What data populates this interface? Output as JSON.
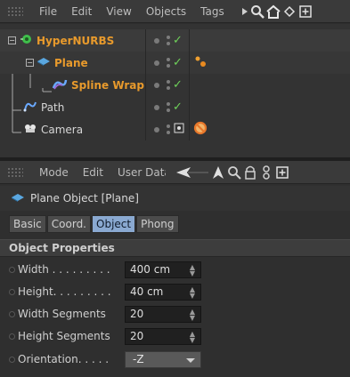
{
  "object_manager": {
    "menu": [
      "File",
      "Edit",
      "View",
      "Objects",
      "Tags"
    ],
    "objects": [
      {
        "name": "HyperNURBS"
      },
      {
        "name": "Plane"
      },
      {
        "name": "Spline Wrap"
      },
      {
        "name": "Path"
      },
      {
        "name": "Camera"
      }
    ]
  },
  "attribute_manager": {
    "menu": [
      "Mode",
      "Edit",
      "User Data"
    ],
    "object_title": "Plane Object [Plane]",
    "tabs": [
      "Basic",
      "Coord.",
      "Object",
      "Phong"
    ],
    "active_tab": "Object",
    "section": "Object Properties",
    "properties": [
      {
        "label": "Width . . . . . . . . .",
        "value": "400 cm"
      },
      {
        "label": "Height. . . . . . . . .",
        "value": "40 cm"
      },
      {
        "label": "Width Segments",
        "value": "20"
      },
      {
        "label": "Height Segments",
        "value": "20"
      },
      {
        "label": "Orientation. . . . .",
        "value": "-Z"
      }
    ]
  },
  "colors": {
    "accent_blue": "#8aa9d1",
    "object_orange": "#e89a2c",
    "check_green": "#6fd15a"
  }
}
